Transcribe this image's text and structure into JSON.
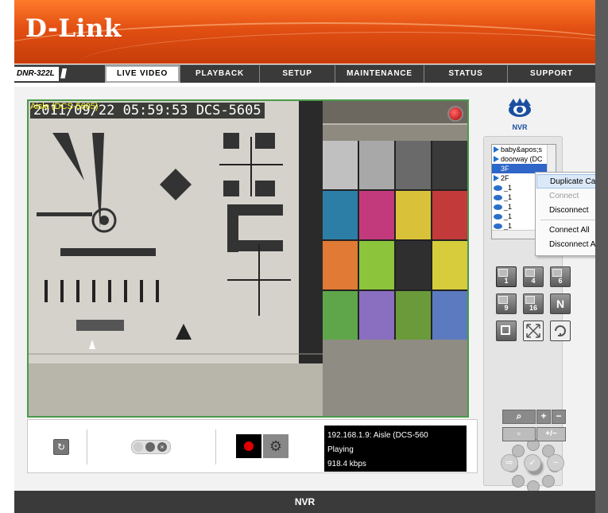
{
  "brand": {
    "logo_text": "D-Link",
    "accent": "#e2521a"
  },
  "nav": {
    "model": "DNR-322L",
    "tabs": [
      "LIVE VIDEO",
      "PLAYBACK",
      "SETUP",
      "MAINTENANCE",
      "STATUS",
      "SUPPORT"
    ],
    "active_tab": "LIVE VIDEO"
  },
  "video": {
    "camera_title": "Aisle (DCS-5605)",
    "osd_text": "2011/09/22 05:59:53 DCS-5605"
  },
  "camera_list": {
    "items": [
      {
        "icon": "play-icon",
        "label": "baby&apos;s"
      },
      {
        "icon": "play-icon",
        "label": "doorway (DC"
      },
      {
        "icon": "play-icon",
        "label": "3F"
      },
      {
        "icon": "play-icon",
        "label": "2F"
      },
      {
        "icon": "camera-eye-icon",
        "label": "_1"
      },
      {
        "icon": "camera-eye-icon",
        "label": "_1"
      },
      {
        "icon": "camera-eye-icon",
        "label": "_1"
      },
      {
        "icon": "camera-eye-icon",
        "label": "_1"
      },
      {
        "icon": "camera-eye-icon",
        "label": "_1"
      }
    ]
  },
  "context_menu": {
    "duplicate": "Duplicate Camera",
    "connect": "Connect",
    "disconnect": "Disconnect",
    "connect_all": "Connect All",
    "disconnect_all": "Disconnect All"
  },
  "layout_buttons": [
    "1",
    "4",
    "6",
    "9",
    "16",
    "N"
  ],
  "ptz": {
    "zoom_in": "+",
    "zoom_out": "−",
    "focus": "+/−"
  },
  "status": {
    "line1": "192.168.1.9: Aisle (DCS-560",
    "line2": "Playing",
    "line3": "918.4 kbps"
  },
  "footer": {
    "text": "NVR"
  }
}
